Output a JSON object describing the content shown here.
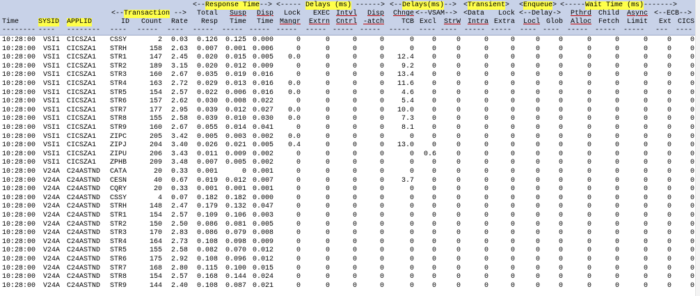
{
  "header": {
    "group_row": [
      {
        "text": "<--",
        "col": "id",
        "span": "id"
      },
      {
        "text": "Transaction",
        "hl": true
      },
      {
        "text": "-->"
      },
      {
        "text": "<--",
        "col": "resp"
      },
      {
        "text": "Response Time",
        "hl": true
      },
      {
        "text": "-->"
      },
      {
        "text": "<-----"
      },
      {
        "text": "Delays (ms)",
        "hl": true
      },
      {
        "text": "------>"
      },
      {
        "text": "<--"
      },
      {
        "text": "Delays(ms)",
        "hl": true
      },
      {
        "text": "-->"
      },
      {
        "text": "<"
      },
      {
        "text": "Transient",
        "hl": true
      },
      {
        "text": ">"
      },
      {
        "text": "<"
      },
      {
        "text": "Enqueue",
        "hl": true
      },
      {
        "text": ">"
      },
      {
        "text": "<-----"
      },
      {
        "text": "Wait Time (ms)",
        "hl": true
      },
      {
        "text": "------->"
      }
    ],
    "sub_row": {
      "total": "Total",
      "susp": "Susp",
      "disp": "Disp",
      "lock": "Lock",
      "exec": "EXEC",
      "intvl": "Intvl",
      "disp2": "Disp",
      "chnge": "Chnge",
      "vsam": "<--VSAM-->",
      "data": "<Data",
      "lock2": "Lock",
      "delay": "<--Delay->",
      "pthrd": "Pthrd",
      "child": "Child",
      "async": "Async",
      "ecb": "<--ECB-->"
    },
    "col_row": {
      "time": "Time",
      "sysid": "SYSID",
      "applid": "APPLID",
      "id": "ID",
      "count": "Count",
      "rate": "Rate",
      "resp": "Resp",
      "susp": "Time",
      "disp": "Time",
      "mangr": "Mangr",
      "extrn": "Extrn",
      "cntrl": "Cntrl",
      "atch": "-atch",
      "tcb": "TCB",
      "excl": "Excl",
      "strw": "StrW",
      "intra": "Intra",
      "extra": "Extra",
      "locl": "Locl",
      "glob": "Glob",
      "alloc": "Alloc",
      "fetch": "Fetch",
      "limit": "Limit",
      "ext": "Ext",
      "cics": "CICS"
    }
  },
  "rows": [
    [
      "10:28:00",
      "VSI1",
      "CICSZA1",
      "CSSY",
      "2",
      "0.03",
      "0.126",
      "0.125",
      "0.000",
      "0",
      "0",
      "0",
      "0",
      "0",
      "0",
      "0",
      "0",
      "0",
      "0",
      "0",
      "0",
      "0",
      "0",
      "0",
      "0"
    ],
    [
      "10:28:00",
      "VSI1",
      "CICSZA1",
      "STRH",
      "158",
      "2.63",
      "0.007",
      "0.001",
      "0.006",
      "0",
      "0",
      "0",
      "0",
      "0",
      "0",
      "0",
      "0",
      "0",
      "0",
      "0",
      "0",
      "0",
      "0",
      "0",
      "0"
    ],
    [
      "10:28:00",
      "VSI1",
      "CICSZA1",
      "STR1",
      "147",
      "2.45",
      "0.020",
      "0.015",
      "0.005",
      "0.0",
      "0",
      "0",
      "0",
      "12.4",
      "0",
      "0",
      "0",
      "0",
      "0",
      "0",
      "0",
      "0",
      "0",
      "0",
      "0"
    ],
    [
      "10:28:00",
      "VSI1",
      "CICSZA1",
      "STR2",
      "189",
      "3.15",
      "0.020",
      "0.012",
      "0.009",
      "0",
      "0",
      "0",
      "0",
      "9.2",
      "0",
      "0",
      "0",
      "0",
      "0",
      "0",
      "0",
      "0",
      "0",
      "0",
      "0"
    ],
    [
      "10:28:00",
      "VSI1",
      "CICSZA1",
      "STR3",
      "160",
      "2.67",
      "0.035",
      "0.019",
      "0.016",
      "0",
      "0",
      "0",
      "0",
      "13.4",
      "0",
      "0",
      "0",
      "0",
      "0",
      "0",
      "0",
      "0",
      "0",
      "0",
      "0"
    ],
    [
      "10:28:00",
      "VSI1",
      "CICSZA1",
      "STR4",
      "163",
      "2.72",
      "0.029",
      "0.013",
      "0.016",
      "0.0",
      "0",
      "0",
      "0",
      "11.6",
      "0",
      "0",
      "0",
      "0",
      "0",
      "0",
      "0",
      "0",
      "0",
      "0",
      "0"
    ],
    [
      "10:28:00",
      "VSI1",
      "CICSZA1",
      "STR5",
      "154",
      "2.57",
      "0.022",
      "0.006",
      "0.016",
      "0.0",
      "0",
      "0",
      "0",
      "4.6",
      "0",
      "0",
      "0",
      "0",
      "0",
      "0",
      "0",
      "0",
      "0",
      "0",
      "0"
    ],
    [
      "10:28:00",
      "VSI1",
      "CICSZA1",
      "STR6",
      "157",
      "2.62",
      "0.030",
      "0.008",
      "0.022",
      "0",
      "0",
      "0",
      "0",
      "5.4",
      "0",
      "0",
      "0",
      "0",
      "0",
      "0",
      "0",
      "0",
      "0",
      "0",
      "0"
    ],
    [
      "10:28:00",
      "VSI1",
      "CICSZA1",
      "STR7",
      "177",
      "2.95",
      "0.039",
      "0.012",
      "0.027",
      "0.0",
      "0",
      "0",
      "0",
      "10.0",
      "0",
      "0",
      "0",
      "0",
      "0",
      "0",
      "0",
      "0",
      "0",
      "0",
      "0"
    ],
    [
      "10:28:00",
      "VSI1",
      "CICSZA1",
      "STR8",
      "155",
      "2.58",
      "0.039",
      "0.010",
      "0.030",
      "0.0",
      "0",
      "0",
      "0",
      "7.3",
      "0",
      "0",
      "0",
      "0",
      "0",
      "0",
      "0",
      "0",
      "0",
      "0",
      "0"
    ],
    [
      "10:28:00",
      "VSI1",
      "CICSZA1",
      "STR9",
      "160",
      "2.67",
      "0.055",
      "0.014",
      "0.041",
      "0",
      "0",
      "0",
      "0",
      "8.1",
      "0",
      "0",
      "0",
      "0",
      "0",
      "0",
      "0",
      "0",
      "0",
      "0",
      "0"
    ],
    [
      "10:28:00",
      "VSI1",
      "CICSZA1",
      "ZIPC",
      "205",
      "3.42",
      "0.005",
      "0.003",
      "0.002",
      "0.0",
      "0",
      "0",
      "0",
      "0",
      "0",
      "0",
      "0",
      "0",
      "0",
      "0",
      "0",
      "0",
      "0",
      "0",
      "0"
    ],
    [
      "10:28:00",
      "VSI1",
      "CICSZA1",
      "ZIPJ",
      "204",
      "3.40",
      "0.026",
      "0.021",
      "0.005",
      "0.4",
      "0",
      "0",
      "0",
      "13.0",
      "0",
      "0",
      "0",
      "0",
      "0",
      "0",
      "0",
      "0",
      "0",
      "0",
      "0"
    ],
    [
      "10:28:00",
      "VSI1",
      "CICSZA1",
      "ZIPU",
      "206",
      "3.43",
      "0.011",
      "0.009",
      "0.002",
      "0",
      "0",
      "0",
      "0",
      "0",
      "0.6",
      "0",
      "0",
      "0",
      "0",
      "0",
      "0",
      "0",
      "0",
      "0",
      "0"
    ],
    [
      "10:28:00",
      "VSI1",
      "CICSZA1",
      "ZPHB",
      "209",
      "3.48",
      "0.007",
      "0.005",
      "0.002",
      "0",
      "0",
      "0",
      "0",
      "0",
      "0",
      "0",
      "0",
      "0",
      "0",
      "0",
      "0",
      "0",
      "0",
      "0",
      "0"
    ],
    [
      "10:28:00",
      "V24A",
      "C24ASTND",
      "CATA",
      "20",
      "0.33",
      "0.001",
      "0",
      "0.001",
      "0",
      "0",
      "0",
      "0",
      "0",
      "0",
      "0",
      "0",
      "0",
      "0",
      "0",
      "0",
      "0",
      "0",
      "0",
      "0"
    ],
    [
      "10:28:00",
      "V24A",
      "C24ASTND",
      "CESN",
      "40",
      "0.67",
      "0.019",
      "0.012",
      "0.007",
      "0",
      "0",
      "0",
      "0",
      "3.7",
      "0",
      "0",
      "0",
      "0",
      "0",
      "0",
      "0",
      "0",
      "0",
      "0",
      "0"
    ],
    [
      "10:28:00",
      "V24A",
      "C24ASTND",
      "CQRY",
      "20",
      "0.33",
      "0.001",
      "0.001",
      "0.001",
      "0",
      "0",
      "0",
      "0",
      "0",
      "0",
      "0",
      "0",
      "0",
      "0",
      "0",
      "0",
      "0",
      "0",
      "0",
      "0"
    ],
    [
      "10:28:00",
      "V24A",
      "C24ASTND",
      "CSSY",
      "4",
      "0.07",
      "0.182",
      "0.182",
      "0.000",
      "0",
      "0",
      "0",
      "0",
      "0",
      "0",
      "0",
      "0",
      "0",
      "0",
      "0",
      "0",
      "0",
      "0",
      "0",
      "0"
    ],
    [
      "10:28:00",
      "V24A",
      "C24ASTND",
      "STRH",
      "148",
      "2.47",
      "0.179",
      "0.132",
      "0.047",
      "0",
      "0",
      "0",
      "0",
      "0",
      "0",
      "0",
      "0",
      "0",
      "0",
      "0",
      "0",
      "0",
      "0",
      "0",
      "0"
    ],
    [
      "10:28:00",
      "V24A",
      "C24ASTND",
      "STR1",
      "154",
      "2.57",
      "0.109",
      "0.106",
      "0.003",
      "0",
      "0",
      "0",
      "0",
      "0",
      "0",
      "0",
      "0",
      "0",
      "0",
      "0",
      "0",
      "0",
      "0",
      "0",
      "0"
    ],
    [
      "10:28:00",
      "V24A",
      "C24ASTND",
      "STR2",
      "150",
      "2.50",
      "0.086",
      "0.081",
      "0.005",
      "0",
      "0",
      "0",
      "0",
      "0",
      "0",
      "0",
      "0",
      "0",
      "0",
      "0",
      "0",
      "0",
      "0",
      "0",
      "0"
    ],
    [
      "10:28:00",
      "V24A",
      "C24ASTND",
      "STR3",
      "170",
      "2.83",
      "0.086",
      "0.079",
      "0.008",
      "0",
      "0",
      "0",
      "0",
      "0",
      "0",
      "0",
      "0",
      "0",
      "0",
      "0",
      "0",
      "0",
      "0",
      "0",
      "0"
    ],
    [
      "10:28:00",
      "V24A",
      "C24ASTND",
      "STR4",
      "164",
      "2.73",
      "0.108",
      "0.098",
      "0.009",
      "0",
      "0",
      "0",
      "0",
      "0",
      "0",
      "0",
      "0",
      "0",
      "0",
      "0",
      "0",
      "0",
      "0",
      "0",
      "0"
    ],
    [
      "10:28:00",
      "V24A",
      "C24ASTND",
      "STR5",
      "155",
      "2.58",
      "0.082",
      "0.070",
      "0.012",
      "0",
      "0",
      "0",
      "0",
      "0",
      "0",
      "0",
      "0",
      "0",
      "0",
      "0",
      "0",
      "0",
      "0",
      "0",
      "0"
    ],
    [
      "10:28:00",
      "V24A",
      "C24ASTND",
      "STR6",
      "175",
      "2.92",
      "0.108",
      "0.096",
      "0.012",
      "0",
      "0",
      "0",
      "0",
      "0",
      "0",
      "0",
      "0",
      "0",
      "0",
      "0",
      "0",
      "0",
      "0",
      "0",
      "0"
    ],
    [
      "10:28:00",
      "V24A",
      "C24ASTND",
      "STR7",
      "168",
      "2.80",
      "0.115",
      "0.100",
      "0.015",
      "0",
      "0",
      "0",
      "0",
      "0",
      "0",
      "0",
      "0",
      "0",
      "0",
      "0",
      "0",
      "0",
      "0",
      "0",
      "0"
    ],
    [
      "10:28:00",
      "V24A",
      "C24ASTND",
      "STR8",
      "154",
      "2.57",
      "0.168",
      "0.144",
      "0.024",
      "0",
      "0",
      "0",
      "0",
      "0",
      "0",
      "0",
      "0",
      "0",
      "0",
      "0",
      "0",
      "0",
      "0",
      "0",
      "0"
    ],
    [
      "10:28:00",
      "V24A",
      "C24ASTND",
      "STR9",
      "144",
      "2.40",
      "0.108",
      "0.087",
      "0.021",
      "0",
      "0",
      "0",
      "0",
      "0",
      "0",
      "0",
      "0",
      "0",
      "0",
      "0",
      "0",
      "0",
      "0",
      "0",
      "0"
    ]
  ],
  "colors": {
    "header_bg": "#c8d2e8",
    "highlight": "#ffff4a",
    "underline": "#c00000"
  }
}
